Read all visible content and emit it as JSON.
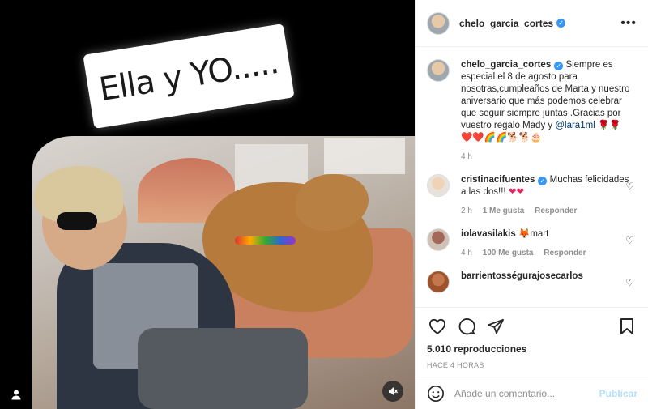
{
  "media": {
    "sticker_text": "Ella y YO....."
  },
  "post": {
    "username": "chelo_garcia_cortes",
    "more": "•••"
  },
  "caption": {
    "username": "chelo_garcia_cortes",
    "text": "Siempre es especial el 8 de agosto para nosotras,cumpleaños de Marta y nuestro aniversario que más podemos celebrar que seguir siempre juntas .Gracias por vuestro regalo Mady y ",
    "mention": "@lara1ml",
    "emojis": "🌹🌹❤️❤️🌈🌈🐕🐕🎂",
    "time": "4 h"
  },
  "comments": [
    {
      "username": "cristinacifuentes",
      "text": "Muchas felicidades a las dos!!!",
      "emojis": "❤❤",
      "time": "2 h",
      "likes": "1 Me gusta",
      "reply": "Responder"
    },
    {
      "username": "iolavasilakis",
      "emoji_prefix": "🦊",
      "text": "mart",
      "time": "4 h",
      "likes": "100 Me gusta",
      "reply": "Responder"
    },
    {
      "username": "barrientosségurajosecarlos"
    }
  ],
  "actions": {
    "views": "5.010 reproducciones",
    "ago": "HACE 4 HORAS"
  },
  "comment_box": {
    "placeholder": "Añade un comentario...",
    "publish": "Publicar"
  },
  "colors": {
    "verified": "#3897f0",
    "publish_disabled": "#b2dffc",
    "heart_red": "#e0245e"
  }
}
